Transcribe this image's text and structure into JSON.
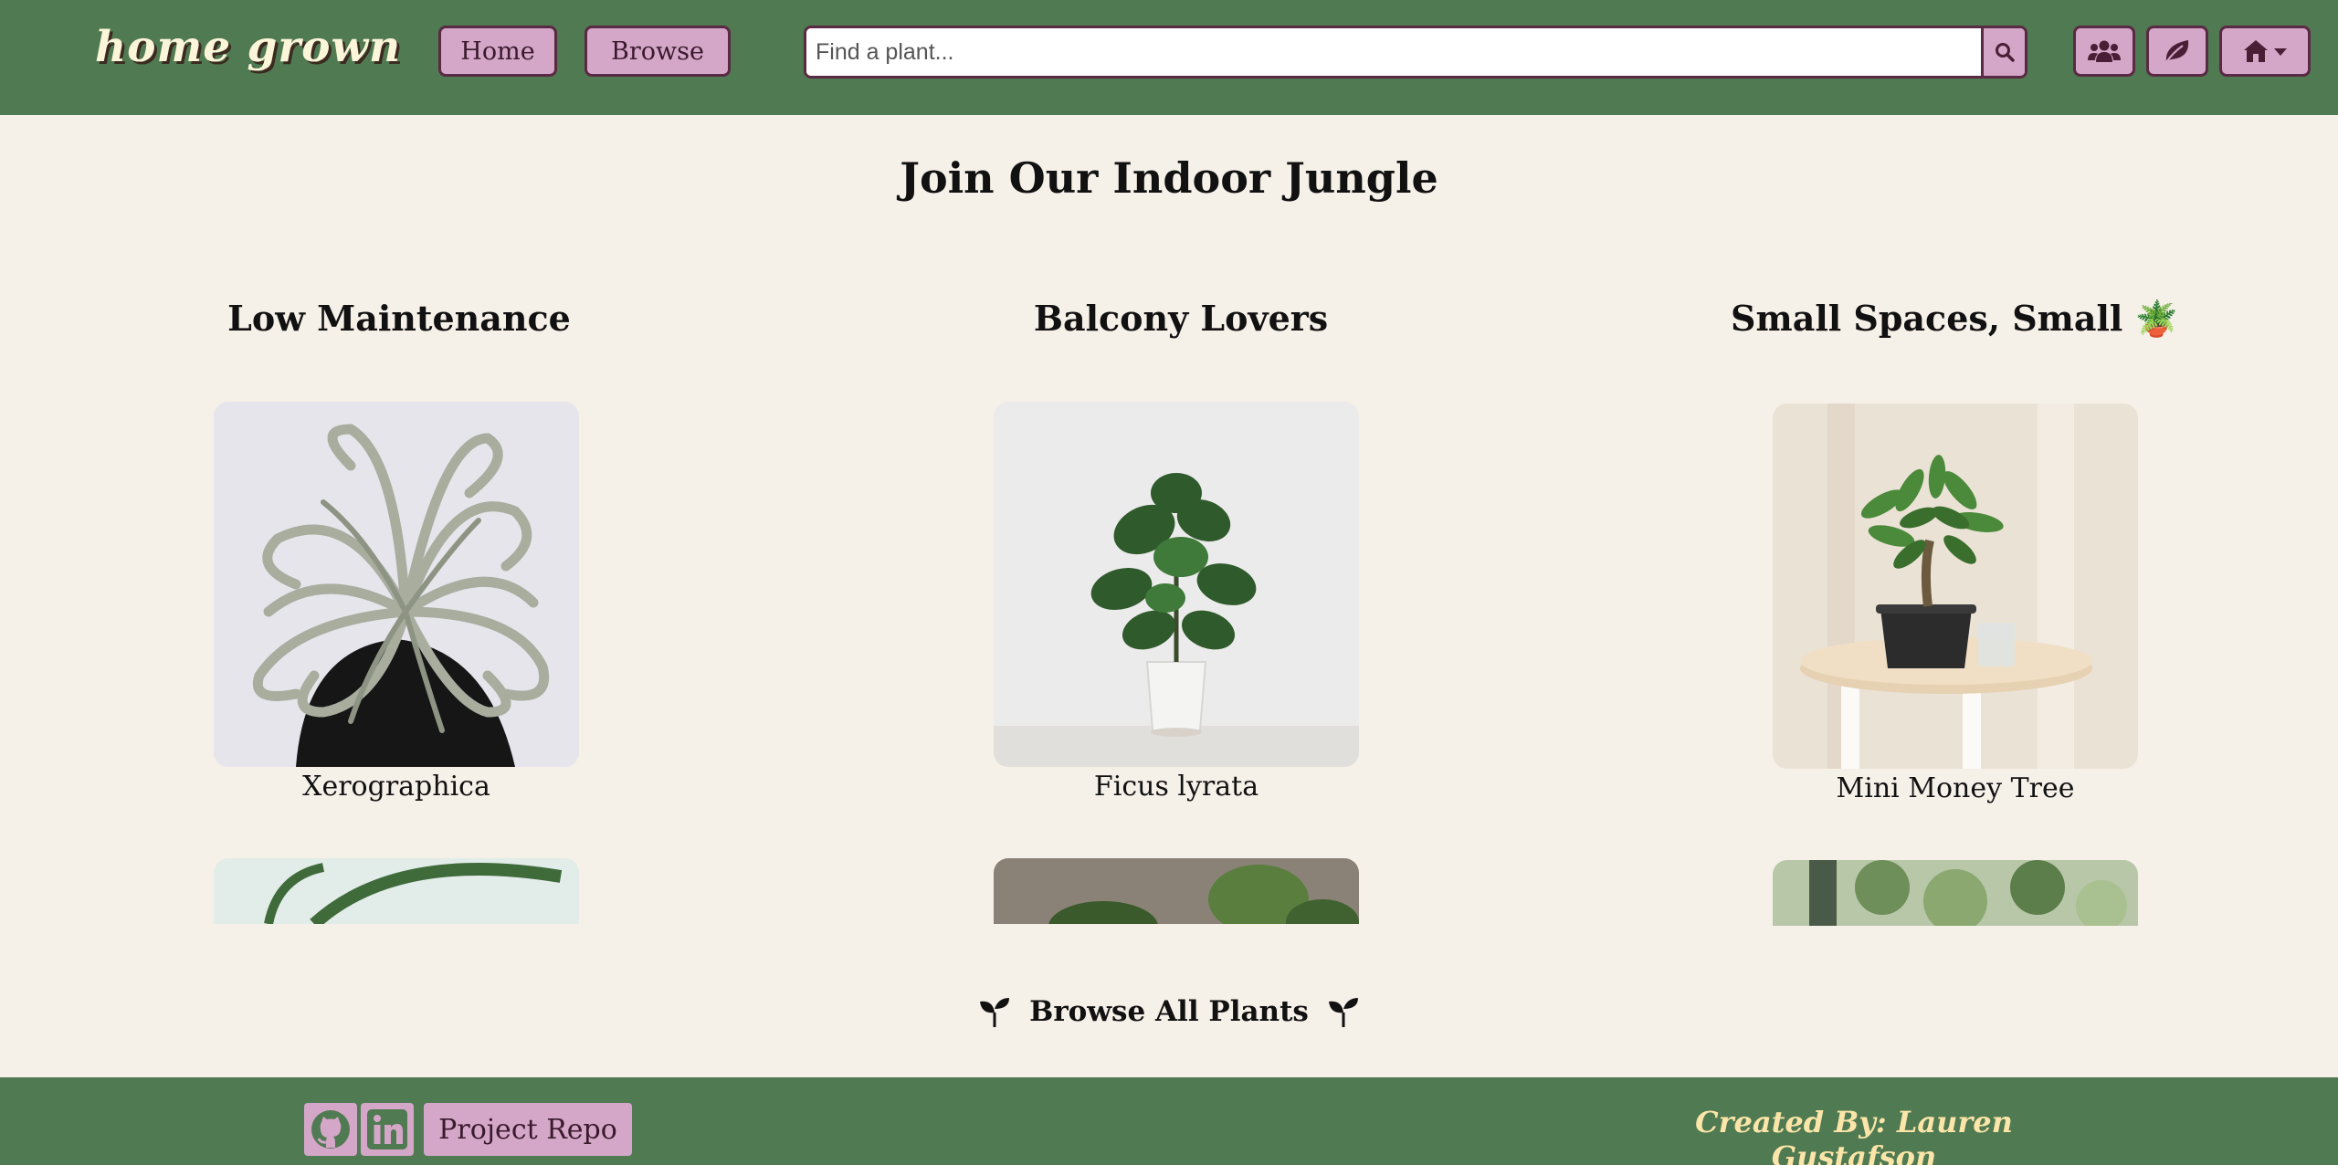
{
  "header": {
    "logo": "home grown",
    "nav": {
      "home": "Home",
      "browse": "Browse"
    },
    "search": {
      "placeholder": "Find a plant..."
    },
    "icons": [
      "users-icon",
      "leaf-icon",
      "home-dropdown-icon"
    ]
  },
  "main": {
    "title": "Join Our Indoor Jungle",
    "columns": [
      {
        "title": "Low Maintenance",
        "plant": "Xerographica"
      },
      {
        "title": "Balcony Lovers",
        "plant": "Ficus lyrata"
      },
      {
        "title": "Small Spaces, Small",
        "title_emoji": "🪴",
        "plant": "Mini Money Tree"
      }
    ],
    "browse_all": "Browse All Plants"
  },
  "footer": {
    "repo": "Project Repo",
    "credit": "Created By: Lauren Gustafson"
  },
  "colors": {
    "header_green": "#507a52",
    "button_pink": "#d4a7c9",
    "button_border": "#5a2a44",
    "background": "#f5f0e8",
    "credit_text": "#fbe5a8"
  }
}
